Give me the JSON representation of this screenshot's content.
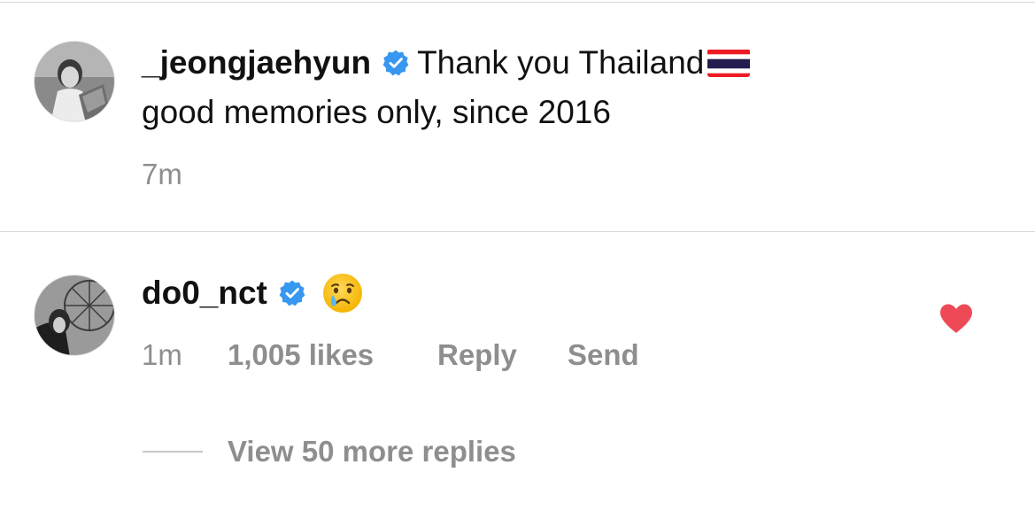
{
  "comments": [
    {
      "username": "_jeongjaehyun",
      "verified": true,
      "text_line1": "Thank you Thailand",
      "text_emoji": "thailand-flag",
      "text_line2": "good memories only, since 2016",
      "time": "7m"
    },
    {
      "username": "do0_nct",
      "verified": true,
      "text_emoji": "crying-face",
      "time": "1m",
      "likes": "1,005 likes",
      "reply_label": "Reply",
      "send_label": "Send",
      "liked": true,
      "view_replies": "View 50 more replies"
    }
  ],
  "colors": {
    "text": "#111111",
    "meta": "#8e8e8e",
    "verified": "#3897f0",
    "heart": "#ed4956",
    "divider": "#dbdbdb"
  }
}
